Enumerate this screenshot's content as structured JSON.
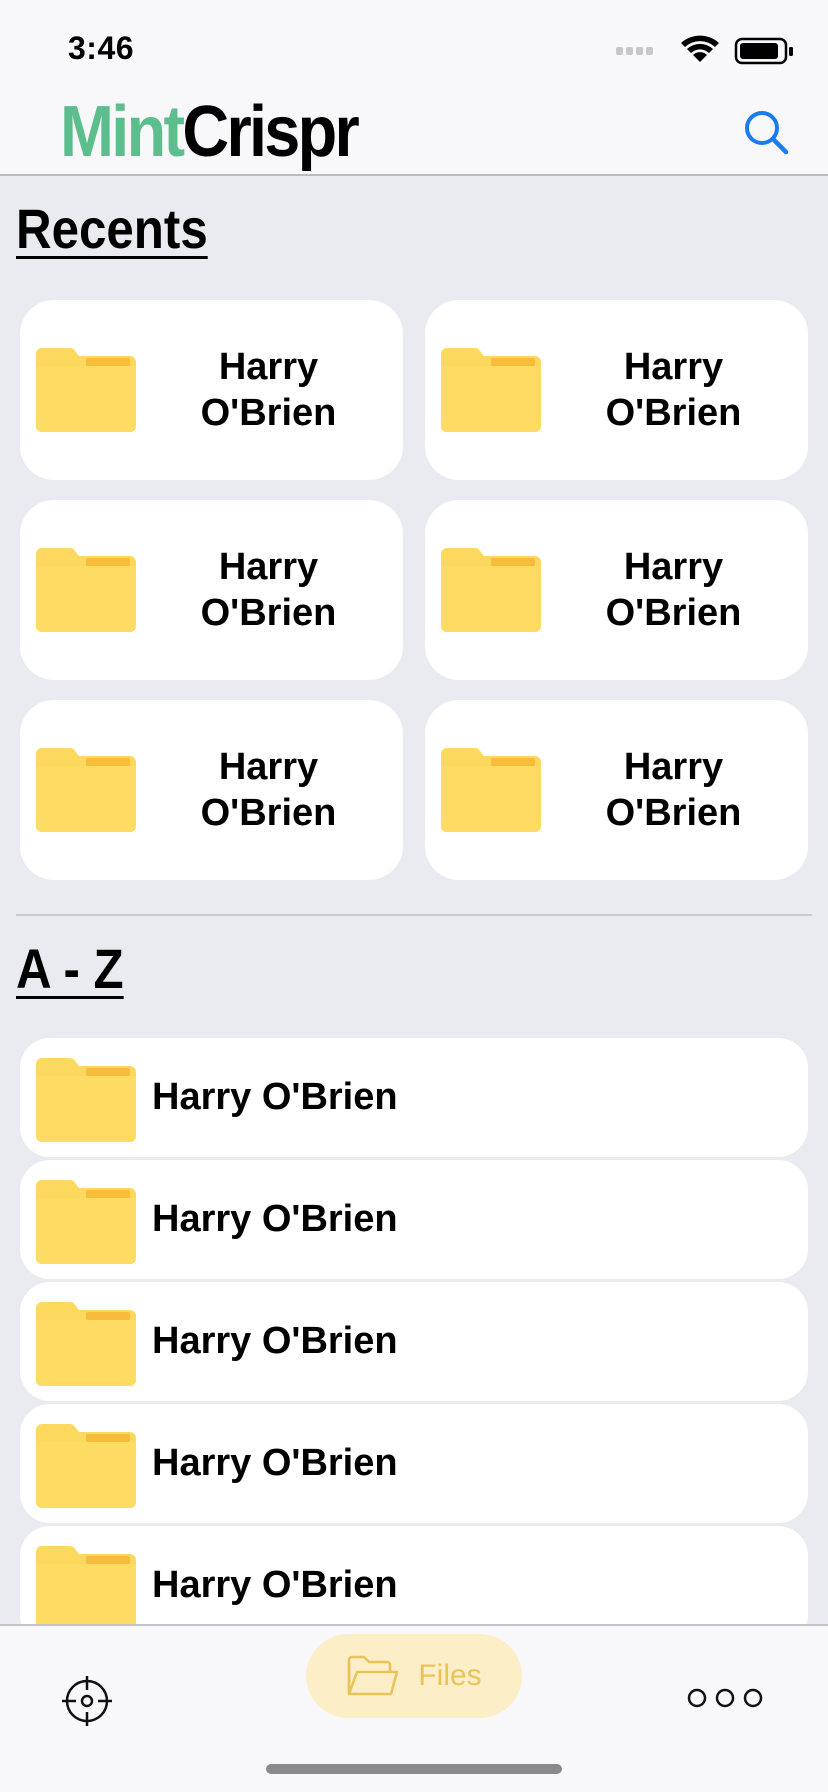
{
  "status_bar": {
    "time": "3:46"
  },
  "header": {
    "brand_part1": "Mint",
    "brand_part2": "Crispr",
    "search_icon": "search-icon",
    "colors": {
      "brand_accent": "#5BBE8C",
      "link_blue": "#1A7CF0"
    }
  },
  "recents": {
    "title": "Recents",
    "items": [
      {
        "line1": "Harry",
        "line2": "O'Brien",
        "icon": "folder-icon"
      },
      {
        "line1": "Harry",
        "line2": "O'Brien",
        "icon": "folder-icon"
      },
      {
        "line1": "Harry",
        "line2": "O'Brien",
        "icon": "folder-icon"
      },
      {
        "line1": "Harry",
        "line2": "O'Brien",
        "icon": "folder-icon"
      },
      {
        "line1": "Harry",
        "line2": "O'Brien",
        "icon": "folder-icon"
      },
      {
        "line1": "Harry",
        "line2": "O'Brien",
        "icon": "folder-icon"
      }
    ]
  },
  "az": {
    "title": "A - Z",
    "items": [
      {
        "label": "Harry O'Brien",
        "icon": "folder-icon"
      },
      {
        "label": "Harry O'Brien",
        "icon": "folder-icon"
      },
      {
        "label": "Harry O'Brien",
        "icon": "folder-icon"
      },
      {
        "label": "Harry O'Brien",
        "icon": "folder-icon"
      },
      {
        "label": "Harry O'Brien",
        "icon": "folder-icon"
      }
    ]
  },
  "tab_bar": {
    "locate_icon": "crosshair-icon",
    "files_label": "Files",
    "files_icon": "open-folder-icon",
    "more_icon": "more-dots-icon",
    "colors": {
      "files_pill": "#FCEFC7",
      "files_text": "#E9C25A"
    }
  }
}
